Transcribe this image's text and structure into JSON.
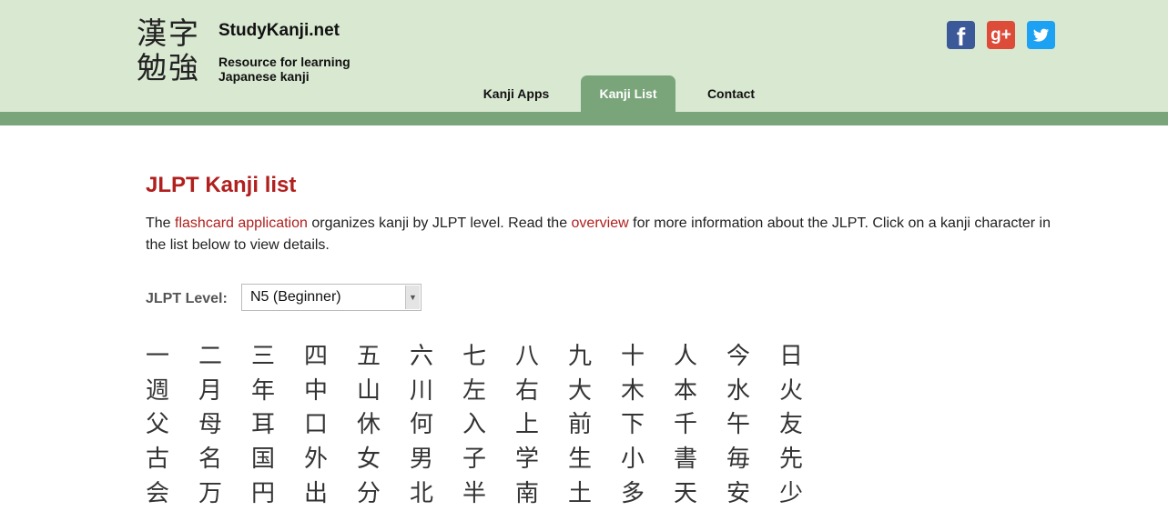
{
  "header": {
    "logo_line1": "漢字",
    "logo_line2": "勉強",
    "site_title": "StudyKanji.net",
    "tagline": "Resource for learning Japanese kanji"
  },
  "nav": {
    "items": [
      {
        "label": "Kanji Apps"
      },
      {
        "label": "Kanji List"
      },
      {
        "label": "Contact"
      }
    ]
  },
  "social": {
    "facebook_label": "f",
    "googleplus_label": "g+",
    "twitter_label": ""
  },
  "main": {
    "title": "JLPT Kanji list",
    "intro_1": "The ",
    "intro_link1": "flashcard application",
    "intro_2": " organizes kanji by JLPT level. Read the ",
    "intro_link2": "overview",
    "intro_3": " for more information about the JLPT. Click on a kanji character in the list below to view details.",
    "level_label": "JLPT Level:",
    "level_value": "N5 (Beginner)"
  },
  "kanji": [
    "一",
    "二",
    "三",
    "四",
    "五",
    "六",
    "七",
    "八",
    "九",
    "十",
    "人",
    "今",
    "日",
    "週",
    "月",
    "年",
    "中",
    "山",
    "川",
    "左",
    "右",
    "大",
    "木",
    "本",
    "水",
    "火",
    "父",
    "母",
    "耳",
    "口",
    "休",
    "何",
    "入",
    "上",
    "前",
    "下",
    "千",
    "午",
    "友",
    "古",
    "名",
    "国",
    "外",
    "女",
    "男",
    "子",
    "学",
    "生",
    "小",
    "書",
    "毎",
    "先",
    "会",
    "万",
    "円",
    "出",
    "分",
    "北",
    "半",
    "南",
    "土",
    "多",
    "天",
    "安",
    "少"
  ],
  "colors": {
    "header_bg": "#d9e8d1",
    "accent_green": "#7aa57a",
    "title_red": "#b0201e"
  }
}
